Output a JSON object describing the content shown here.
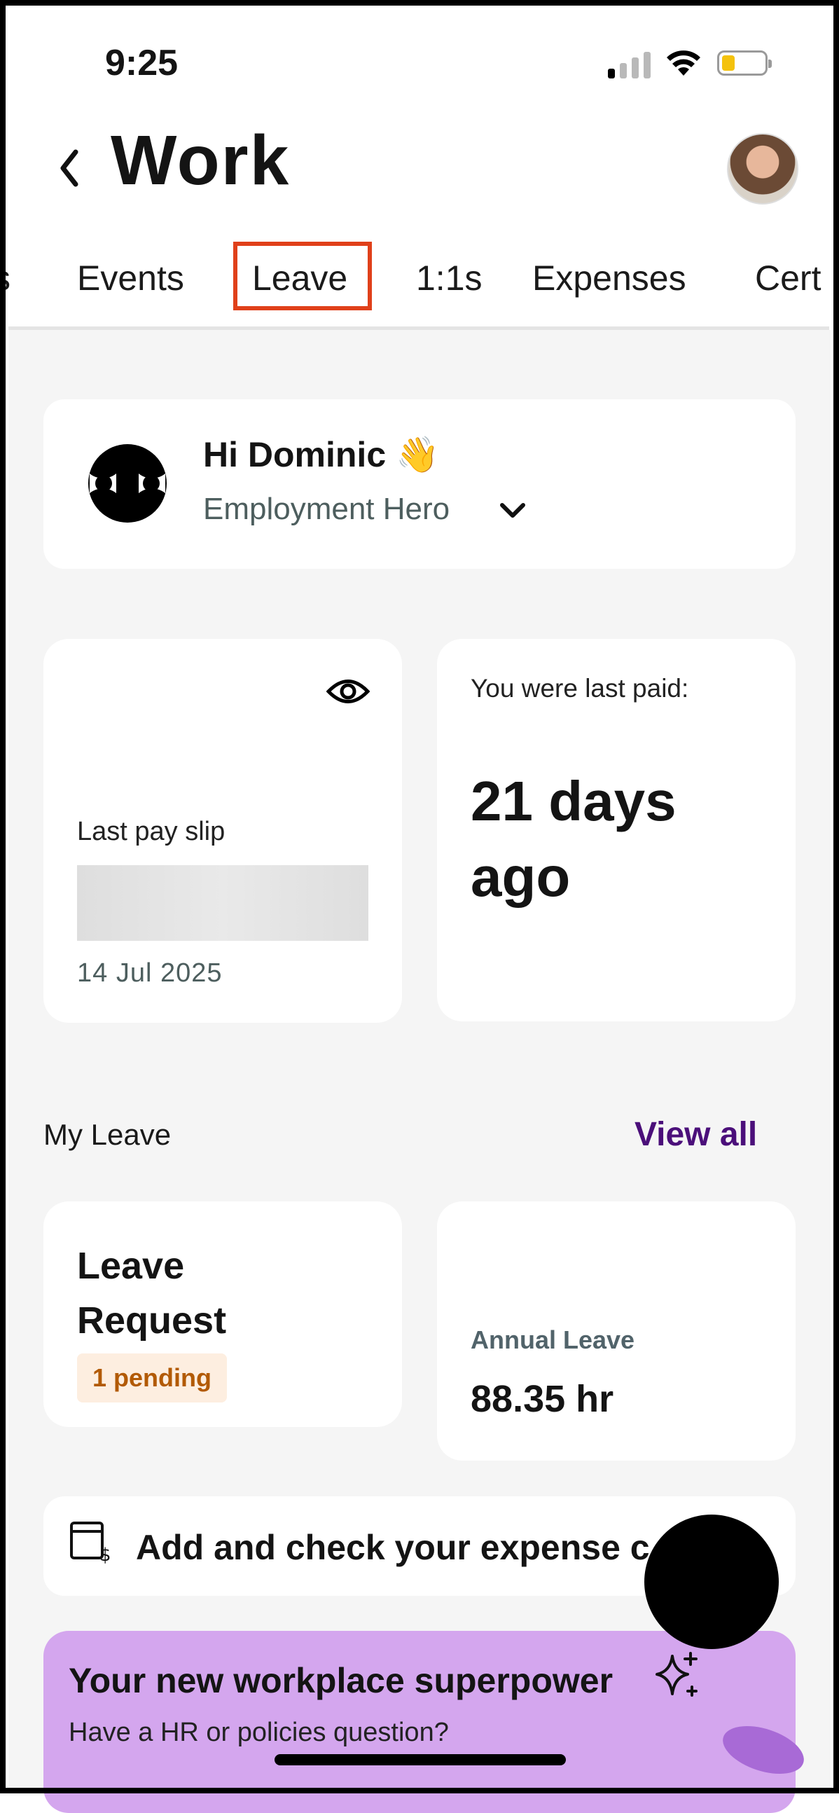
{
  "status_bar": {
    "time": "9:25"
  },
  "header": {
    "title": "Work"
  },
  "tabs": [
    {
      "label": "s"
    },
    {
      "label": "Events"
    },
    {
      "label": "Leave"
    },
    {
      "label": "1:1s"
    },
    {
      "label": "Expenses"
    },
    {
      "label": "Cert"
    }
  ],
  "selected_tab": "Leave",
  "greeting": {
    "name": "Hi Dominic 👋",
    "organisation": "Employment Hero"
  },
  "pay_slip": {
    "label": "Last pay slip",
    "date": "14 Jul 2025"
  },
  "last_paid": {
    "label": "You were last paid:",
    "value": "21 days ago"
  },
  "my_leave": {
    "heading": "My Leave",
    "view_all": "View all",
    "request": {
      "title": "Leave Request",
      "pending": "1 pending"
    },
    "annual": {
      "label": "Annual Leave",
      "value": "88.35 hr"
    }
  },
  "expense_banner": {
    "text": "Add and check your expense c"
  },
  "ai_banner": {
    "title": "Your new workplace superpower",
    "subtitle": "Have a HR or policies question?"
  },
  "colors": {
    "highlight": "#e0401a",
    "link": "#4b0f7a",
    "pending_bg": "#fdeee0",
    "pending_text": "#b25a05",
    "ai_bg": "#d4a6ee"
  },
  "icons": [
    "back-chevron-icon",
    "eye-icon",
    "chevron-down-icon",
    "expense-receipt-icon",
    "plus-icon",
    "sparkle-icon"
  ]
}
